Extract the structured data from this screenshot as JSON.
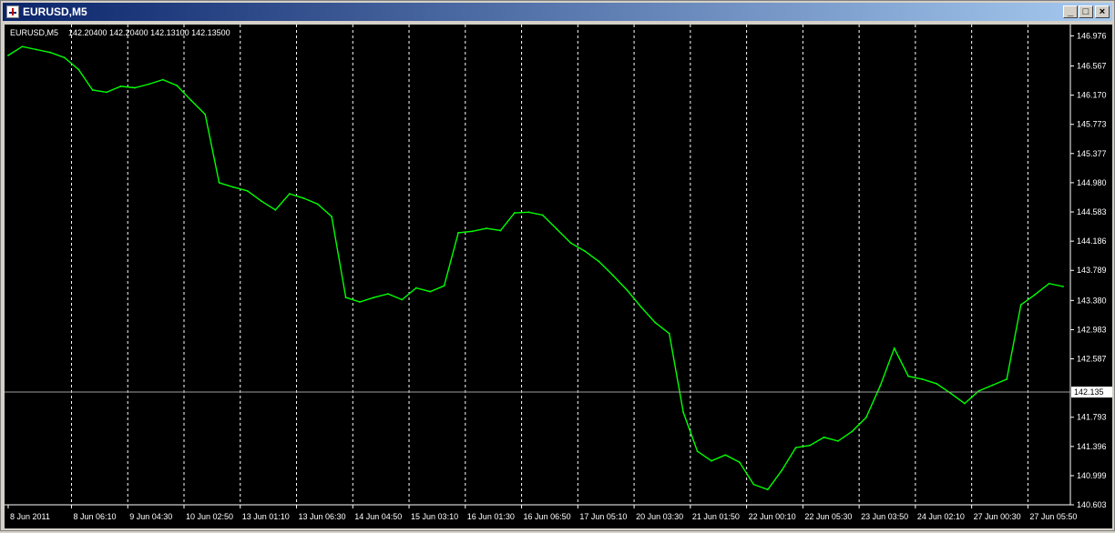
{
  "window": {
    "title": "EURUSD,M5",
    "minimize_label": "_",
    "maximize_label": "□",
    "close_label": "×"
  },
  "chart_header": {
    "symbol": "EURUSD,M5",
    "ohlc": "142.20400 142.20400 142.13100 142.13500"
  },
  "colors": {
    "background": "#000000",
    "series": "#00ff00",
    "grid": "#ffffff",
    "axis_text": "#ffffff"
  },
  "chart_data": {
    "type": "line",
    "title": "EURUSD,M5",
    "grid": true,
    "ylim": [
      140.603,
      147.08
    ],
    "current_price": 142.135,
    "current_price_label": "142.135",
    "y_ticks": [
      {
        "label": "146.976",
        "value": 146.976
      },
      {
        "label": "146.567",
        "value": 146.567
      },
      {
        "label": "146.170",
        "value": 146.17
      },
      {
        "label": "145.773",
        "value": 145.773
      },
      {
        "label": "145.377",
        "value": 145.377
      },
      {
        "label": "144.980",
        "value": 144.98
      },
      {
        "label": "144.583",
        "value": 144.583
      },
      {
        "label": "144.186",
        "value": 144.186
      },
      {
        "label": "143.789",
        "value": 143.789
      },
      {
        "label": "143.380",
        "value": 143.38
      },
      {
        "label": "142.983",
        "value": 142.983
      },
      {
        "label": "142.587",
        "value": 142.587
      },
      {
        "label": "141.793",
        "value": 141.793
      },
      {
        "label": "141.396",
        "value": 141.396
      },
      {
        "label": "140.999",
        "value": 140.999
      },
      {
        "label": "140.603",
        "value": 140.603
      }
    ],
    "x_labels": [
      "8 Jun 2011",
      "8 Jun 06:10",
      "9 Jun 04:30",
      "10 Jun 02:50",
      "13 Jun 01:10",
      "13 Jun 06:30",
      "14 Jun 04:50",
      "15 Jun 03:10",
      "16 Jun 01:30",
      "16 Jun 06:50",
      "17 Jun 05:10",
      "20 Jun 03:30",
      "21 Jun 01:50",
      "22 Jun 00:10",
      "22 Jun 05:30",
      "23 Jun 03:50",
      "24 Jun 02:10",
      "27 Jun 00:30",
      "27 Jun 05:50"
    ],
    "session_breaks": [
      5,
      9,
      13,
      17,
      21,
      25,
      29,
      33,
      37,
      41,
      45,
      49,
      53,
      57,
      61,
      65,
      69,
      73
    ],
    "x_count": 76,
    "series": [
      {
        "values": [
          146.71,
          146.83,
          146.79,
          146.75,
          146.68,
          146.52,
          146.24,
          146.21,
          146.29,
          146.27,
          146.32,
          146.38,
          146.3,
          146.1,
          145.91,
          144.98,
          144.92,
          144.87,
          144.73,
          144.61,
          144.83,
          144.77,
          144.69,
          144.52,
          143.42,
          143.36,
          143.42,
          143.47,
          143.39,
          143.55,
          143.5,
          143.58,
          144.3,
          144.32,
          144.36,
          144.33,
          144.57,
          144.58,
          144.54,
          144.35,
          144.16,
          144.05,
          143.91,
          143.72,
          143.52,
          143.29,
          143.08,
          142.93,
          141.86,
          141.33,
          141.2,
          141.28,
          141.18,
          140.88,
          140.81,
          141.07,
          141.38,
          141.41,
          141.52,
          141.47,
          141.6,
          141.79,
          142.22,
          142.73,
          142.35,
          142.31,
          142.25,
          142.12,
          141.98,
          142.15,
          142.23,
          142.31,
          143.32,
          143.46,
          143.61,
          143.57
        ]
      }
    ]
  }
}
